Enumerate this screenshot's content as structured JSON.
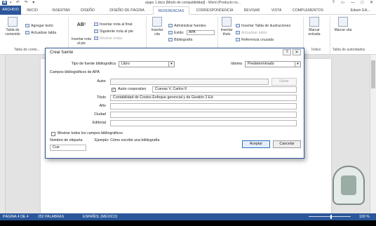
{
  "window": {
    "title": "ejapo 1.docx [Modo de compatibilidad] - Word (Producto no...",
    "app_icon": "word-icon",
    "qat": [
      "save-icon",
      "undo-icon",
      "redo-icon",
      "customize-icon"
    ],
    "controls": [
      "?",
      "▭",
      "—",
      "□",
      "✕"
    ]
  },
  "tabs": {
    "file": "ARCHIVO",
    "items": [
      "INICIO",
      "INSERTAR",
      "DISEÑO",
      "DISEÑO DE PÁGINA",
      "REFERENCIAS",
      "CORRESPONDENCIA",
      "REVISAR",
      "VISTA",
      "COMPLEMENTOS"
    ],
    "active": "REFERENCIAS",
    "user": "Edwin EA..."
  },
  "ribbon": {
    "toc_button": "Tabla de contenido",
    "add_text": "Agregar texto",
    "update_table": "Actualizar tabla",
    "group_toc": "Tabla de conte...",
    "footnote_icon": "AB¹",
    "insert_footnote": "Insertar nota al pie",
    "insert_endnote": "Insertar nota al final",
    "next_footnote": "Siguiente nota al pie",
    "show_notes": "Mostrar notas",
    "insert_citation": "Insertar cita",
    "manage_sources": "Administrar fuentes",
    "style_label": "Estilo:",
    "style_value": "APA",
    "bibliography": "Bibliografía",
    "insert_caption": "Insertar título",
    "insert_table_figures": "Insertar Tabla de ilustraciones",
    "update_table2": "Actualizar tabla",
    "cross_reference": "Referencia cruzada",
    "mark_entry": "Marcar entrada",
    "group_index": "Índice",
    "mark_citation": "Marcar cita",
    "group_authorities": "Tabla de autoridades"
  },
  "dialog": {
    "title": "Crear fuente",
    "help": "?",
    "close": "✕",
    "source_type_label": "Tipo de fuente bibliográfica",
    "source_type_value": "Libro",
    "language_label": "Idioma",
    "language_value": "Predeterminado",
    "section_label": "Campos bibliográficos de APA",
    "author_label": "Autor",
    "author_value": "",
    "edit_button": "Editar",
    "corporate_author_label": "Autor corporativo",
    "corporate_author_checked": true,
    "corporate_author_value": "Cuevas V. Carlos F.",
    "title_label": "Título",
    "title_value": "Contabilidad de Costos Enfoque gerencial y de Gestión 2 Ed",
    "year_label": "Año",
    "year_value": "",
    "city_label": "Ciudad",
    "city_value": "",
    "publisher_label": "Editorial",
    "publisher_value": "",
    "show_all_fields_label": "Mostrar todos los campos bibliográficos",
    "show_all_fields_checked": false,
    "tag_name_label": "Nombre de etiqueta",
    "tag_name_value": "Cue",
    "example_text": "Ejemplo: Cómo escribir una bibliografía",
    "accept_button": "Aceptar",
    "cancel_button": "Cancelar"
  },
  "status": {
    "page": "PÁGINA 4 DE 4",
    "words": "252 PALABRAS",
    "language": "ESPAÑOL (MÉXICO)",
    "zoom": "100 %",
    "zoom_fraction": 0.5
  }
}
